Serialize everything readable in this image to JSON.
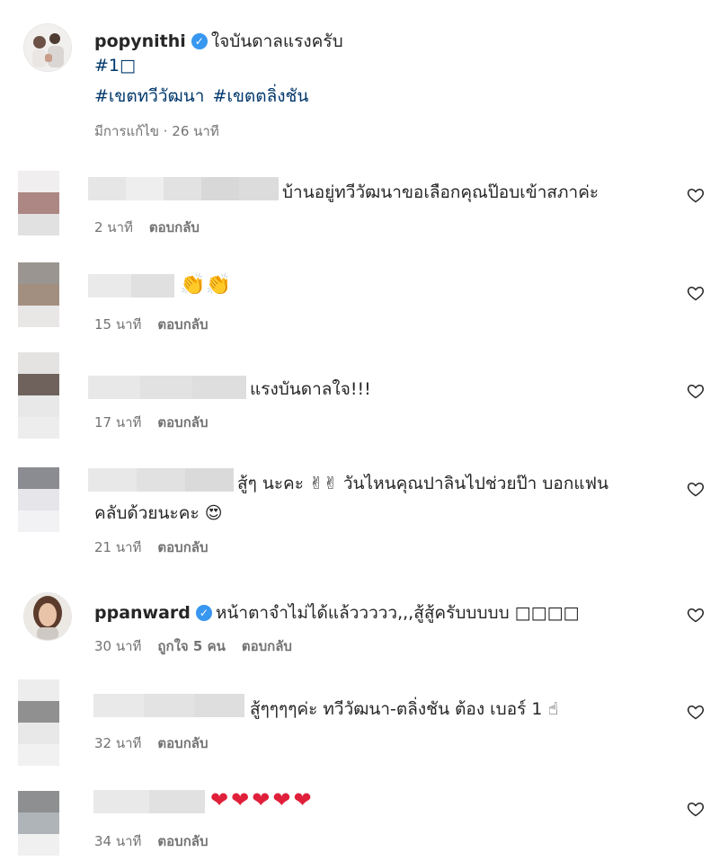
{
  "post": {
    "username": "popynithi",
    "caption": "ใจบันดาลแรงครับ",
    "hashtag_line1": "#1□",
    "hashtags": [
      "#เขตทวีวัฒนา",
      "#เขตตลิ่งชัน"
    ],
    "edited_time": "มีการแก้ไข · 26 นาที"
  },
  "reply_label": "ตอบกลับ",
  "comments": [
    {
      "text": "บ้านอยู่ทวีวัฒนาขอเลือกคุณป๊อบเข้าสภาค่ะ",
      "time": "2 นาที"
    },
    {
      "text": "👏👏",
      "time": "15 นาที"
    },
    {
      "text": "แรงบันดาลใจ!!!",
      "time": "17 นาที"
    },
    {
      "text": "สู้ๆ นะคะ ✌✌ วันไหนคุณปาลินไปช่วยป๊า บอกแฟน",
      "text2": "คลับด้วยนะคะ 😍",
      "time": "21 นาที"
    },
    {
      "username": "ppanward",
      "text": "หน้าตาจำไม่ได้แล้ววววว,,,สู้สู้ครับบบบบ □□□□",
      "time": "30 นาที",
      "likes": "ถูกใจ 5 คน"
    },
    {
      "text": "สู้ๆๆๆๆค่ะ ทวีวัฒนา-ตลิ่งชัน ต้อง เบอร์ 1 ☝",
      "time": "32 นาที"
    },
    {
      "text": "❤❤❤❤❤",
      "time": "34 นาที"
    }
  ],
  "icons": {
    "like": "heart-outline-icon",
    "verified": "verified-badge-icon"
  },
  "colors": {
    "hashtag": "#00376b",
    "verified": "#3897f0",
    "meta": "#737373"
  }
}
